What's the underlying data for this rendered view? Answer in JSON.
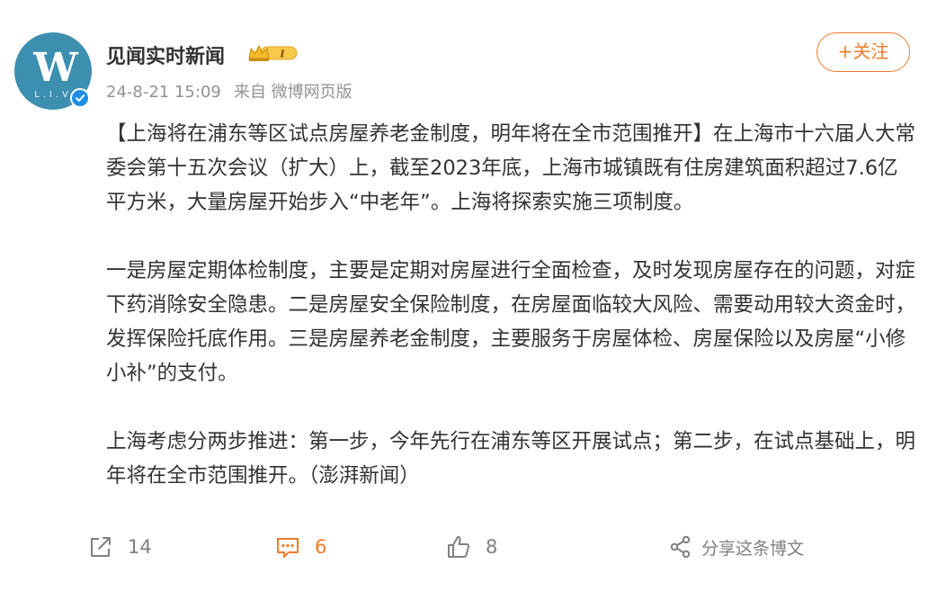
{
  "post": {
    "author": {
      "name": "见闻实时新闻",
      "avatar_text": "W",
      "avatar_subtext": "L.I.V",
      "vip_badge": "I",
      "verified_icon": "verified-badge-icon"
    },
    "timestamp": "24-8-21 15:09",
    "source": "来自 微博网页版",
    "follow_label": "+关注",
    "paragraphs": [
      "【上海将在浦东等区试点房屋养老金制度，明年将在全市范围推开】在上海市十六届人大常委会第十五次会议（扩大）上，截至2023年底，上海市城镇既有住房建筑面积超过7.6亿平方米，大量房屋开始步入“中老年”。上海将探索实施三项制度。",
      "一是房屋定期体检制度，主要是定期对房屋进行全面检查，及时发现房屋存在的问题，对症下药消除安全隐患。二是房屋安全保险制度，在房屋面临较大风险、需要动用较大资金时，发挥保险托底作用。三是房屋养老金制度，主要服务于房屋体检、房屋保险以及房屋“小修小补”的支付。",
      "上海考虑分两步推进：第一步，今年先行在浦东等区开展试点；第二步，在试点基础上，明年将在全市范围推开。（澎湃新闻）"
    ],
    "actions": {
      "repost_count": "14",
      "comment_count": "6",
      "like_count": "8",
      "share_label": "分享这条博文"
    }
  },
  "colors": {
    "accent": "#f07b2a",
    "verified": "#1c8ee8",
    "meta_text": "#939393",
    "body_text": "#333333"
  }
}
